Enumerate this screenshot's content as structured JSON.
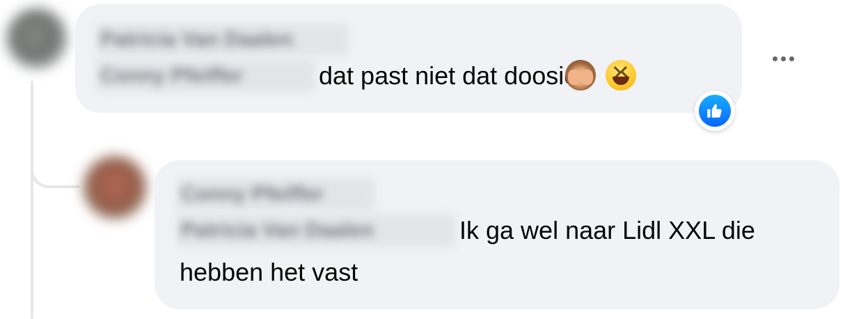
{
  "comments": [
    {
      "author": "Patricia Van Daalen",
      "mention": "Conny Pfeiffer",
      "text": "dat past niet dat doosie",
      "emojis": [
        "see-no-evil-monkey-icon",
        "grinning-squinting-face-icon"
      ],
      "reaction": "like-icon"
    },
    {
      "author": "Conny Pfeiffer",
      "mention": "Patricia Van Daalen",
      "text_line1": "Ik ga wel naar Lidl XXL die",
      "text_line2": "hebben het vast"
    }
  ],
  "colors": {
    "bubble": "#f0f2f5",
    "text": "#050505",
    "like_blue": "#0866ff",
    "thread_line": "#e4e6eb"
  }
}
